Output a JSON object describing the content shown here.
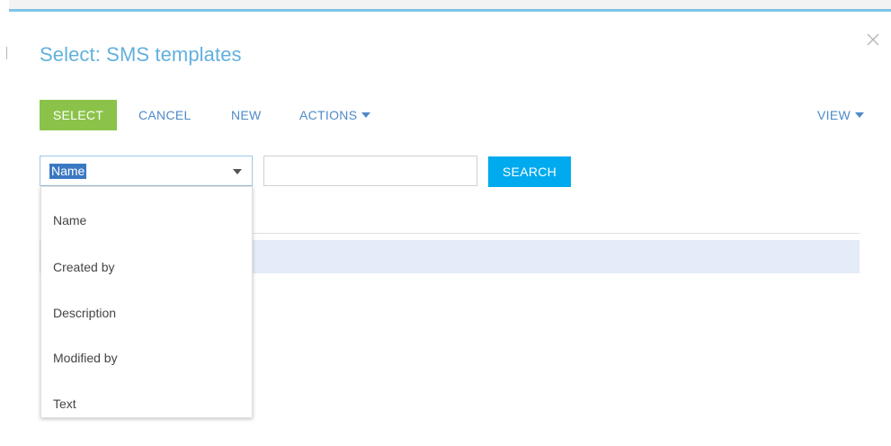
{
  "dialog": {
    "title": "Select: SMS templates",
    "close_icon": "close-icon",
    "accent_color": "#62b0de"
  },
  "toolbar": {
    "select_label": "SELECT",
    "cancel_label": "CANCEL",
    "new_label": "NEW",
    "actions_label": "ACTIONS",
    "view_label": "VIEW"
  },
  "filter": {
    "selected_column": "Name",
    "search_value": "",
    "search_button_label": "SEARCH",
    "options": [
      "Name",
      "Created by",
      "Description",
      "Modified by",
      "Text"
    ]
  },
  "colors": {
    "select_button": "#8bc34a",
    "search_button": "#00aaee",
    "link_text": "#4d8ac9",
    "selected_row": "#e4ebf9"
  }
}
